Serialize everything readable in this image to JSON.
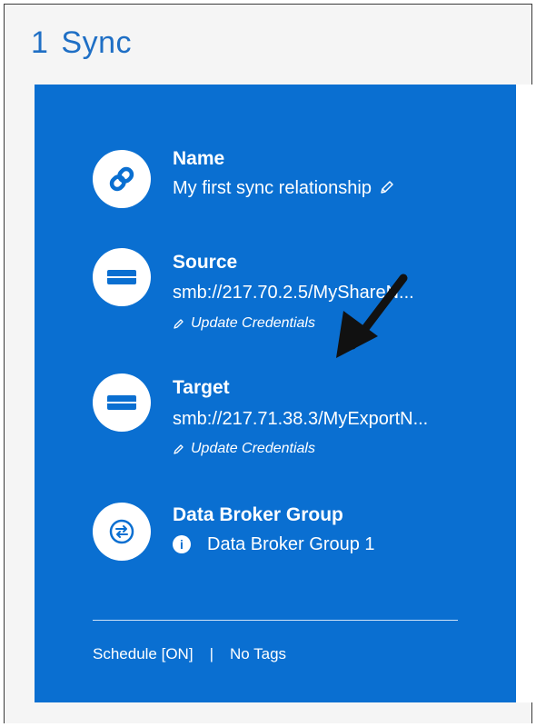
{
  "header": {
    "number": "1",
    "title": "Sync"
  },
  "name": {
    "label": "Name",
    "value": "My first sync relationship",
    "icon": "link-icon"
  },
  "source": {
    "label": "Source",
    "value": "smb://217.70.2.5/MyShareN...",
    "action": "Update Credentials",
    "icon": "storage-icon"
  },
  "target": {
    "label": "Target",
    "value": "smb://217.71.38.3/MyExportN...",
    "action": "Update Credentials",
    "icon": "storage-icon"
  },
  "broker": {
    "label": "Data Broker Group",
    "value": "Data Broker Group 1",
    "icon": "sync-icon"
  },
  "footer": {
    "schedule": "Schedule [ON]",
    "separator": "|",
    "tags": "No Tags"
  },
  "colors": {
    "card_background": "#0a6fd1",
    "title": "#1f6fc5",
    "icon": "#0a6fd1"
  }
}
